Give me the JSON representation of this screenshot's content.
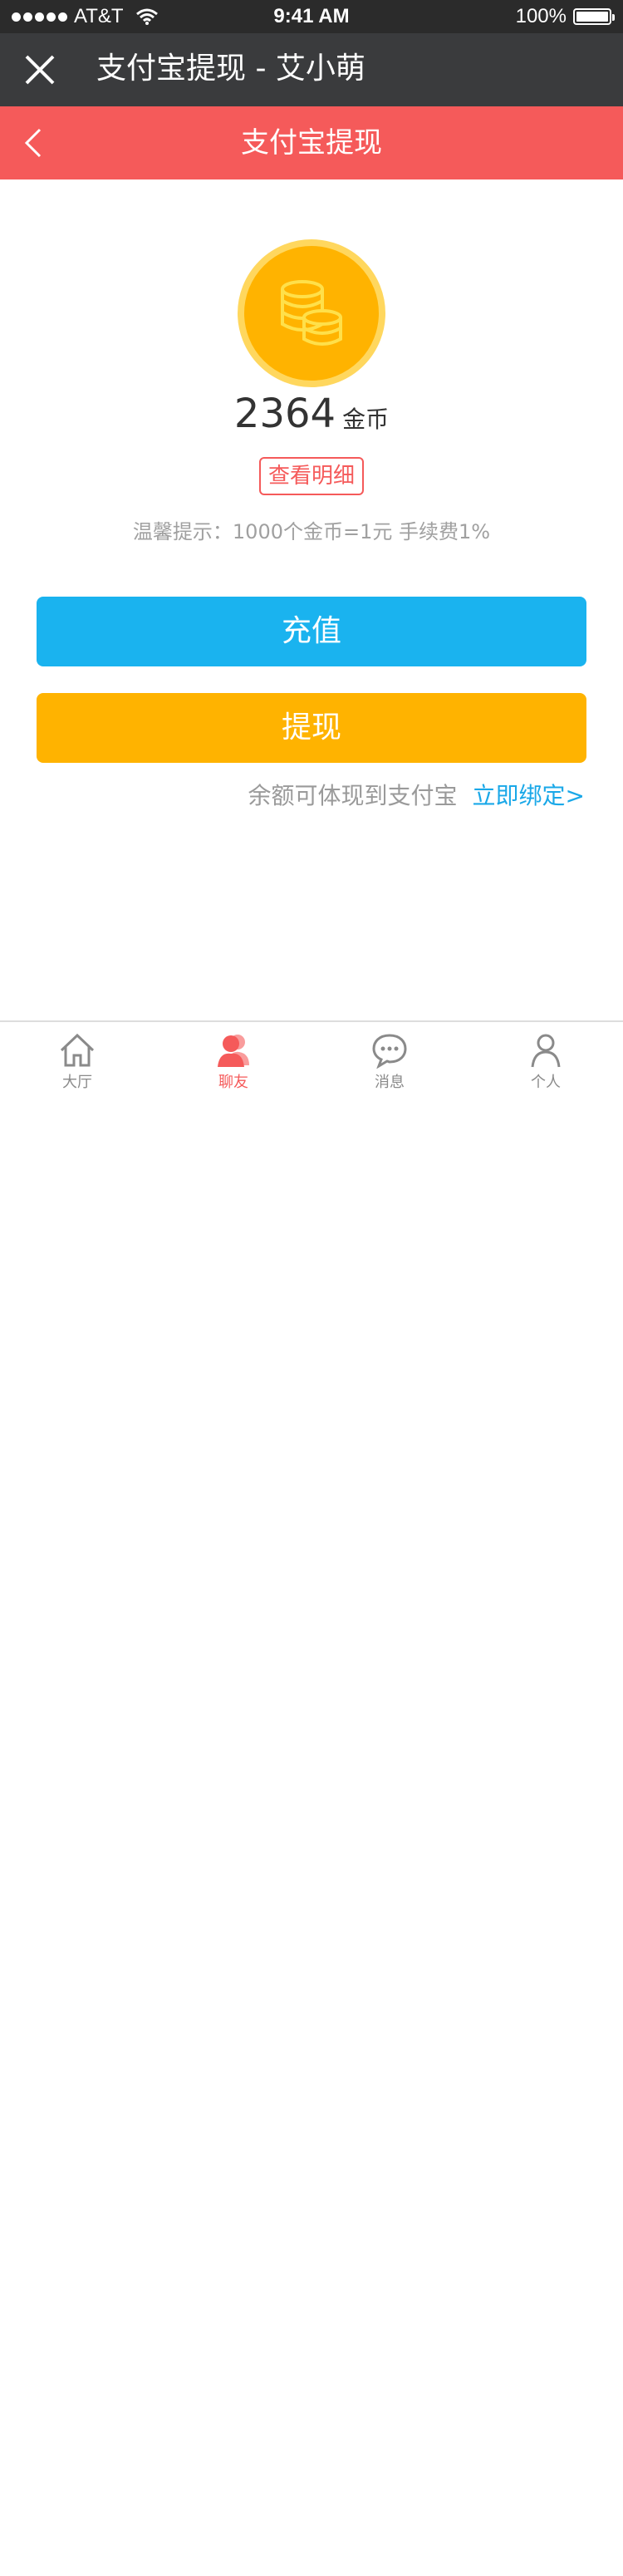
{
  "status_bar": {
    "carrier": "AT&T",
    "time": "9:41 AM",
    "battery": "100%"
  },
  "wechat_bar": {
    "title": "支付宝提现 - 艾小萌"
  },
  "header": {
    "title": "支付宝提现"
  },
  "balance": {
    "amount": "2364",
    "unit": "金币"
  },
  "detail_button": "查看明细",
  "tip": "温馨提示：1000个金币=1元   手续费1%",
  "buttons": {
    "recharge": "充值",
    "withdraw": "提现"
  },
  "bind": {
    "hint": "余额可体现到支付宝",
    "link": "立即绑定>"
  },
  "tabs": [
    {
      "label": "大厅",
      "icon": "home-icon",
      "active": false
    },
    {
      "label": "聊友",
      "icon": "friends-icon",
      "active": true
    },
    {
      "label": "消息",
      "icon": "message-icon",
      "active": false
    },
    {
      "label": "个人",
      "icon": "person-icon",
      "active": false
    }
  ],
  "colors": {
    "header_red": "#f55a5a",
    "recharge_blue": "#1ab3ef",
    "withdraw_orange": "#ffb300",
    "link_blue": "#1aa8e8"
  }
}
